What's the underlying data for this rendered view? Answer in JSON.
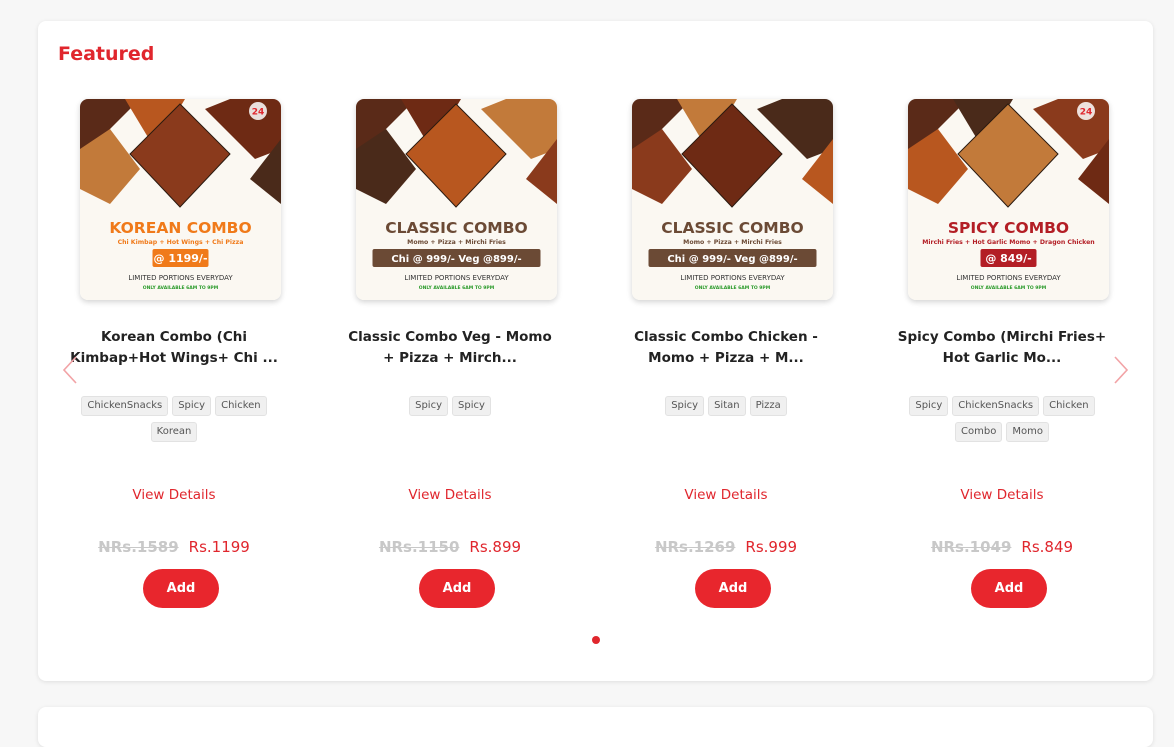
{
  "section": {
    "title": "Featured"
  },
  "products": [
    {
      "name": "Korean Combo (Chi Kimbap+Hot Wings+ Chi ...",
      "tags": [
        "ChickenSnacks",
        "Spicy",
        "Chicken",
        "Korean"
      ],
      "view_details": "View Details",
      "old_price": "NRs.1589",
      "new_price": "Rs.1199",
      "add_label": "Add",
      "image": {
        "headline": "KOREAN COMBO",
        "subline": "Chi Kimbap + Hot Wings + Chi Pizza",
        "price_tag": "@ 1199/-",
        "limited": "LIMITED PORTIONS EVERYDAY",
        "available": "ONLY AVAILABLE 6AM TO 9PM",
        "accent": "#f07a1a",
        "badge": "24"
      }
    },
    {
      "name": "Classic Combo Veg - Momo + Pizza + Mirch...",
      "tags": [
        "Spicy",
        "Spicy"
      ],
      "view_details": "View Details",
      "old_price": "NRs.1150",
      "new_price": "Rs.899",
      "add_label": "Add",
      "image": {
        "headline": "CLASSIC COMBO",
        "subline": "Momo + Pizza + Mirchi Fries",
        "price_tag": "Chi @ 999/-   Veg @899/-",
        "limited": "LIMITED PORTIONS EVERYDAY",
        "available": "ONLY AVAILABLE 6AM TO 9PM",
        "accent": "#6b4a35"
      }
    },
    {
      "name": "Classic Combo Chicken - Momo + Pizza + M...",
      "tags": [
        "Spicy",
        "Sitan",
        "Pizza"
      ],
      "view_details": "View Details",
      "old_price": "NRs.1269",
      "new_price": "Rs.999",
      "add_label": "Add",
      "image": {
        "headline": "CLASSIC COMBO",
        "subline": "Momo + Pizza + Mirchi Fries",
        "price_tag": "Chi @ 999/-   Veg @899/-",
        "limited": "LIMITED PORTIONS EVERYDAY",
        "available": "ONLY AVAILABLE 6AM TO 9PM",
        "accent": "#6b4a35"
      }
    },
    {
      "name": "Spicy Combo (Mirchi Fries+ Hot Garlic Mo...",
      "tags": [
        "Spicy",
        "ChickenSnacks",
        "Chicken",
        "Combo",
        "Momo"
      ],
      "view_details": "View Details",
      "old_price": "NRs.1049",
      "new_price": "Rs.849",
      "add_label": "Add",
      "image": {
        "headline": "SPICY COMBO",
        "subline": "Mirchi Fries + Hot Garlic Momo + Dragon Chicken",
        "price_tag": "@ 849/-",
        "limited": "LIMITED PORTIONS EVERYDAY",
        "available": "ONLY AVAILABLE 6AM TO 9PM",
        "accent": "#b31e25",
        "badge": "24"
      }
    }
  ],
  "carousel": {
    "prev_icon": "chevron-left-icon",
    "next_icon": "chevron-right-icon",
    "active_page": 1
  },
  "colors": {
    "brand_red": "#e0262d",
    "tag_bg": "#f0f0f0",
    "muted_price": "#c8c8c8"
  }
}
